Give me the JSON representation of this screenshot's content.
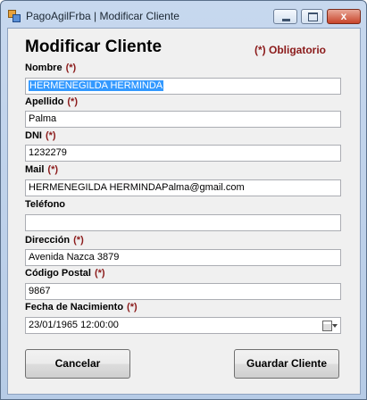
{
  "window": {
    "title": "PagoAgilFrba | Modificar Cliente",
    "minimize_label": "",
    "maximize_label": "",
    "close_label": "x"
  },
  "form": {
    "heading": "Modificar Cliente",
    "required_note": "(*) Obligatorio",
    "required_mark": "(*)",
    "fields": {
      "nombre": {
        "label": "Nombre",
        "value": "HERMENEGILDA  HERMINDA"
      },
      "apellido": {
        "label": "Apellido",
        "value": "Palma"
      },
      "dni": {
        "label": "DNI",
        "value": "1232279"
      },
      "mail": {
        "label": "Mail",
        "value": "HERMENEGILDA  HERMINDAPalma@gmail.com"
      },
      "telefono": {
        "label": "Teléfono",
        "value": ""
      },
      "direccion": {
        "label": "Dirección",
        "value": "Avenida Nazca 3879"
      },
      "codigo_postal": {
        "label": "Código Postal",
        "value": "9867"
      },
      "fecha_nacimiento": {
        "label": "Fecha de Nacimiento",
        "value": "23/01/1965 12:00:00"
      }
    }
  },
  "buttons": {
    "cancel": "Cancelar",
    "save": "Guardar Cliente"
  }
}
